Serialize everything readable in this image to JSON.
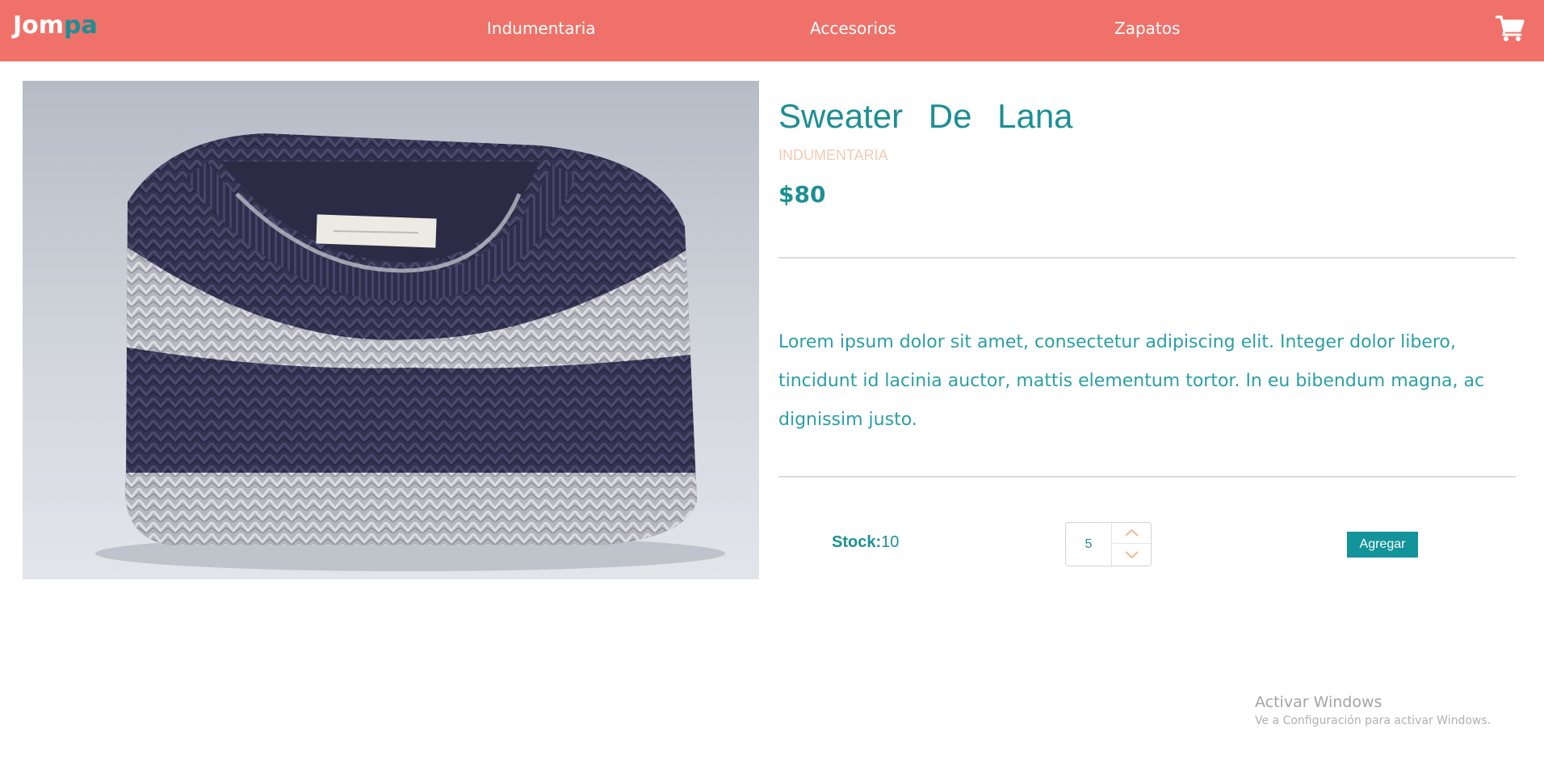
{
  "header": {
    "brand_part1": "Jom",
    "brand_part2": "pa",
    "nav": [
      {
        "label": "Indumentaria"
      },
      {
        "label": "Accesorios"
      },
      {
        "label": "Zapatos"
      }
    ],
    "cart_icon": "shopping-cart-icon"
  },
  "product": {
    "image_alt": "sweater-photo",
    "title": "Sweater De Lana",
    "category": "INDUMENTARIA",
    "price": "$80",
    "description": "Lorem ipsum dolor sit amet, consectetur adipiscing elit. Integer dolor libero, tincidunt id lacinia auctor, mattis elementum tortor. In eu bibendum magna, ac dignissim justo.",
    "stock_label": "Stock:",
    "stock_value": "10",
    "quantity": "5",
    "add_label": "Agregar"
  },
  "watermark": {
    "line1": "Activar Windows",
    "line2": "Ve a Configuración para activar Windows."
  },
  "colors": {
    "navbar": "#f07169",
    "accent": "#1b8f95",
    "category": "#f4cbb2",
    "button": "#13939a"
  }
}
